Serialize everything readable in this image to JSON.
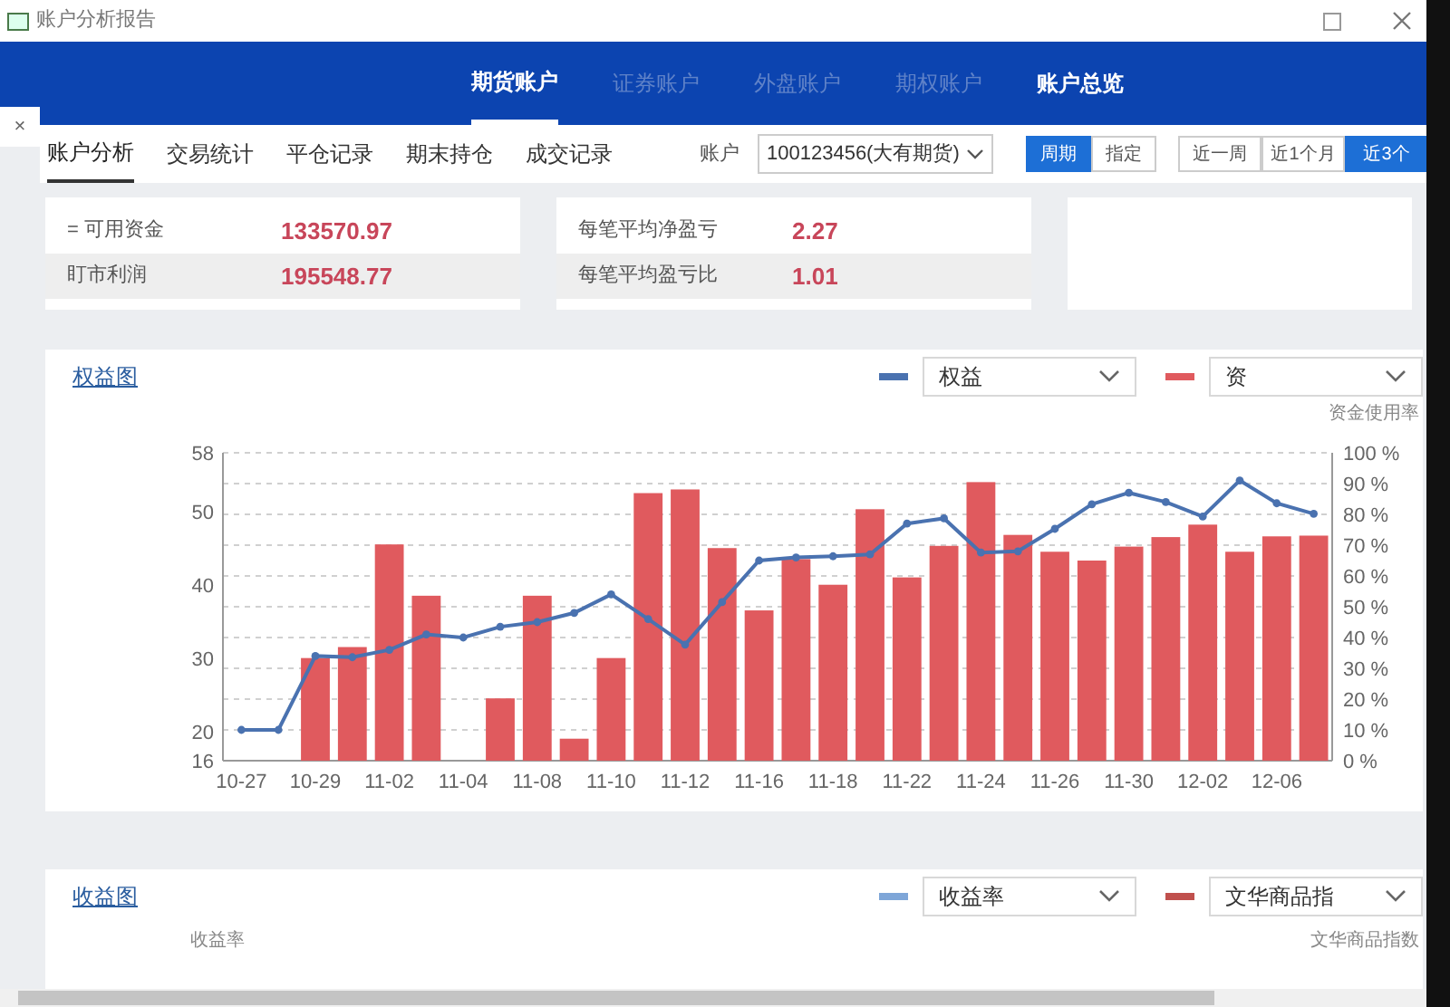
{
  "window": {
    "title": "账户分析报告"
  },
  "nav": [
    {
      "label": "期货账户",
      "selected": true,
      "disabled": false
    },
    {
      "label": "证券账户",
      "selected": false,
      "disabled": true
    },
    {
      "label": "外盘账户",
      "selected": false,
      "disabled": true
    },
    {
      "label": "期权账户",
      "selected": false,
      "disabled": true
    },
    {
      "label": "账户总览",
      "selected": false,
      "disabled": false
    }
  ],
  "close_tab": "×",
  "tabs": [
    {
      "label": "账户分析",
      "selected": true
    },
    {
      "label": "交易统计",
      "selected": false
    },
    {
      "label": "平仓记录",
      "selected": false
    },
    {
      "label": "期末持仓",
      "selected": false
    },
    {
      "label": "成交记录",
      "selected": false
    }
  ],
  "account": {
    "label": "账户",
    "value": "100123456(大有期货)"
  },
  "mode_buttons": [
    {
      "label": "周期",
      "selected": true
    },
    {
      "label": "指定",
      "selected": false
    }
  ],
  "range_buttons": [
    {
      "label": "近一周",
      "selected": false
    },
    {
      "label": "近1个月",
      "selected": false
    },
    {
      "label": "近3个",
      "selected": true
    }
  ],
  "stats": [
    [
      {
        "label": "= 可用资金",
        "value": "133570.97"
      },
      {
        "label": "盯市利润",
        "value": "195548.77"
      }
    ],
    [
      {
        "label": "每笔平均净盈亏",
        "value": "2.27"
      },
      {
        "label": "每笔平均盈亏比",
        "value": "1.01"
      }
    ]
  ],
  "equity_chart": {
    "title": "权益图",
    "right_axis_label": "资金使用率",
    "chart_data": {
      "type": "bar",
      "categories": [
        "10-27",
        null,
        "10-29",
        null,
        "11-02",
        null,
        "11-04",
        null,
        "11-08",
        null,
        "11-10",
        null,
        "11-12",
        null,
        "11-16",
        null,
        "11-18",
        null,
        "11-22",
        null,
        "11-24",
        null,
        "11-26",
        null,
        "11-30",
        null,
        "12-02",
        null,
        "12-06",
        null
      ],
      "grid": true,
      "ylim": [
        16,
        58
      ],
      "yticks": [
        16,
        20,
        30,
        40,
        50,
        58
      ],
      "y2lim": [
        0,
        100
      ],
      "y2ticks": [
        {
          "value": 0,
          "label": "0 %"
        },
        {
          "value": 10,
          "label": "10 %"
        },
        {
          "value": 20,
          "label": "20 %"
        },
        {
          "value": 30,
          "label": "30 %"
        },
        {
          "value": 40,
          "label": "40 %"
        },
        {
          "value": 50,
          "label": "50 %"
        },
        {
          "value": 60,
          "label": "60 %"
        },
        {
          "value": 70,
          "label": "70 %"
        },
        {
          "value": 80,
          "label": "80 %"
        },
        {
          "value": 90,
          "label": "90 %"
        },
        {
          "value": 100,
          "label": "100 %"
        }
      ],
      "series": [
        {
          "name": "权益",
          "type": "line",
          "marker": true,
          "axis": "y2",
          "color": "#4a72b0",
          "values": [
            10,
            10,
            34,
            33.6,
            36,
            41,
            40,
            43.5,
            45,
            48,
            54,
            46,
            37.7,
            51.5,
            65,
            66,
            66.4,
            67,
            77,
            78.7,
            67.6,
            68,
            75.3,
            83.3,
            87,
            84,
            79.3,
            91,
            83.6,
            80.2
          ]
        },
        {
          "name": "资",
          "color": "#e05a5e",
          "values": [
            null,
            null,
            30,
            31.5,
            45.5,
            38.5,
            null,
            24.5,
            38.5,
            19,
            30,
            52.5,
            53,
            45,
            36.5,
            43.5,
            40,
            50.3,
            41,
            45.3,
            54,
            46.8,
            44.5,
            43.3,
            45.2,
            46.5,
            48.2,
            44.5,
            46.6,
            46.7
          ]
        }
      ]
    }
  },
  "return_chart": {
    "title": "收益图",
    "legend": [
      {
        "value": "收益率",
        "color": "#7ea6d8"
      },
      {
        "value": "文华商品指",
        "color": "#c0504d"
      }
    ],
    "left_axis_label": "收益率",
    "right_axis_label": "文华商品指数"
  }
}
